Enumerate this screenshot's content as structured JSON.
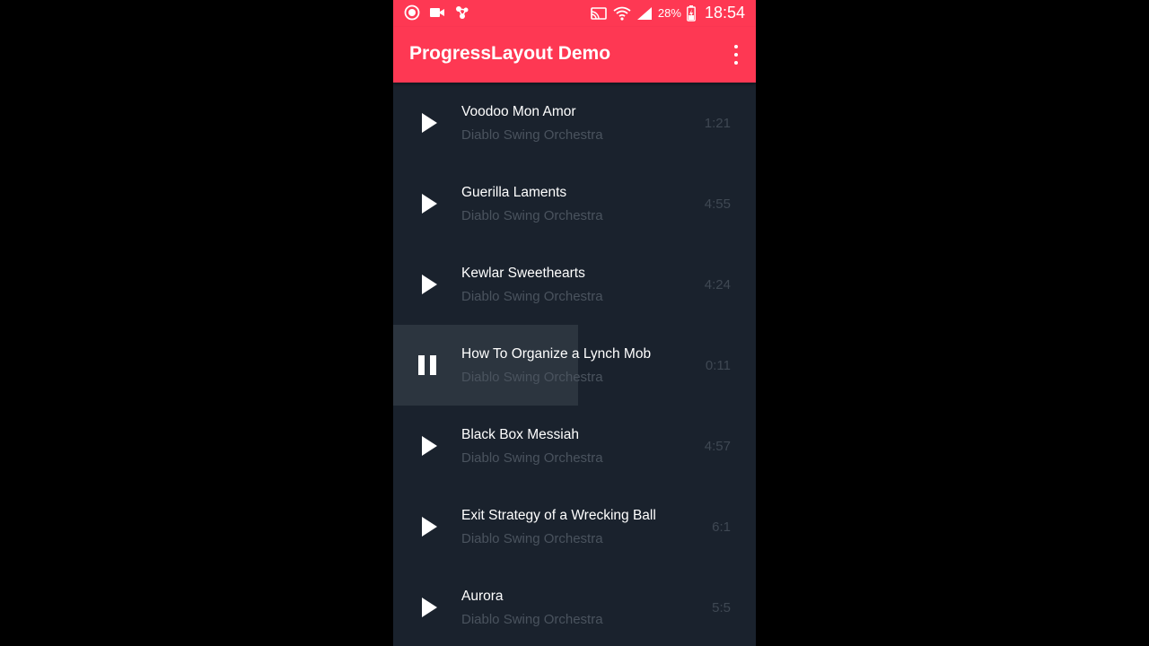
{
  "status_bar": {
    "battery": "28%",
    "time": "18:54",
    "icons": [
      "record-icon",
      "video-icon",
      "sync-icon",
      "cast-icon",
      "wifi-icon",
      "signal-icon",
      "battery-charging-icon"
    ]
  },
  "app_bar": {
    "title": "ProgressLayout Demo",
    "menu_icon": "more-vert-icon"
  },
  "colors": {
    "accent": "#fe3853",
    "background": "#1a222d",
    "progress": "#2c353f"
  },
  "tracks": [
    {
      "title": "Voodoo Mon Amor",
      "artist": "Diablo Swing Orchestra",
      "duration": "1:21",
      "state": "play",
      "progress": 0
    },
    {
      "title": "Guerilla Laments",
      "artist": "Diablo Swing Orchestra",
      "duration": "4:55",
      "state": "play",
      "progress": 0
    },
    {
      "title": "Kewlar Sweethearts",
      "artist": "Diablo Swing Orchestra",
      "duration": "4:24",
      "state": "play",
      "progress": 0
    },
    {
      "title": "How To Organize a Lynch Mob",
      "artist": "Diablo Swing Orchestra",
      "duration": "0:11",
      "state": "pause",
      "progress": 0.51
    },
    {
      "title": "Black Box Messiah",
      "artist": "Diablo Swing Orchestra",
      "duration": "4:57",
      "state": "play",
      "progress": 0
    },
    {
      "title": "Exit Strategy of a Wrecking Ball",
      "artist": "Diablo Swing Orchestra",
      "duration": "6:1",
      "state": "play",
      "progress": 0
    },
    {
      "title": "Aurora",
      "artist": "Diablo Swing Orchestra",
      "duration": "5:5",
      "state": "play",
      "progress": 0
    }
  ]
}
